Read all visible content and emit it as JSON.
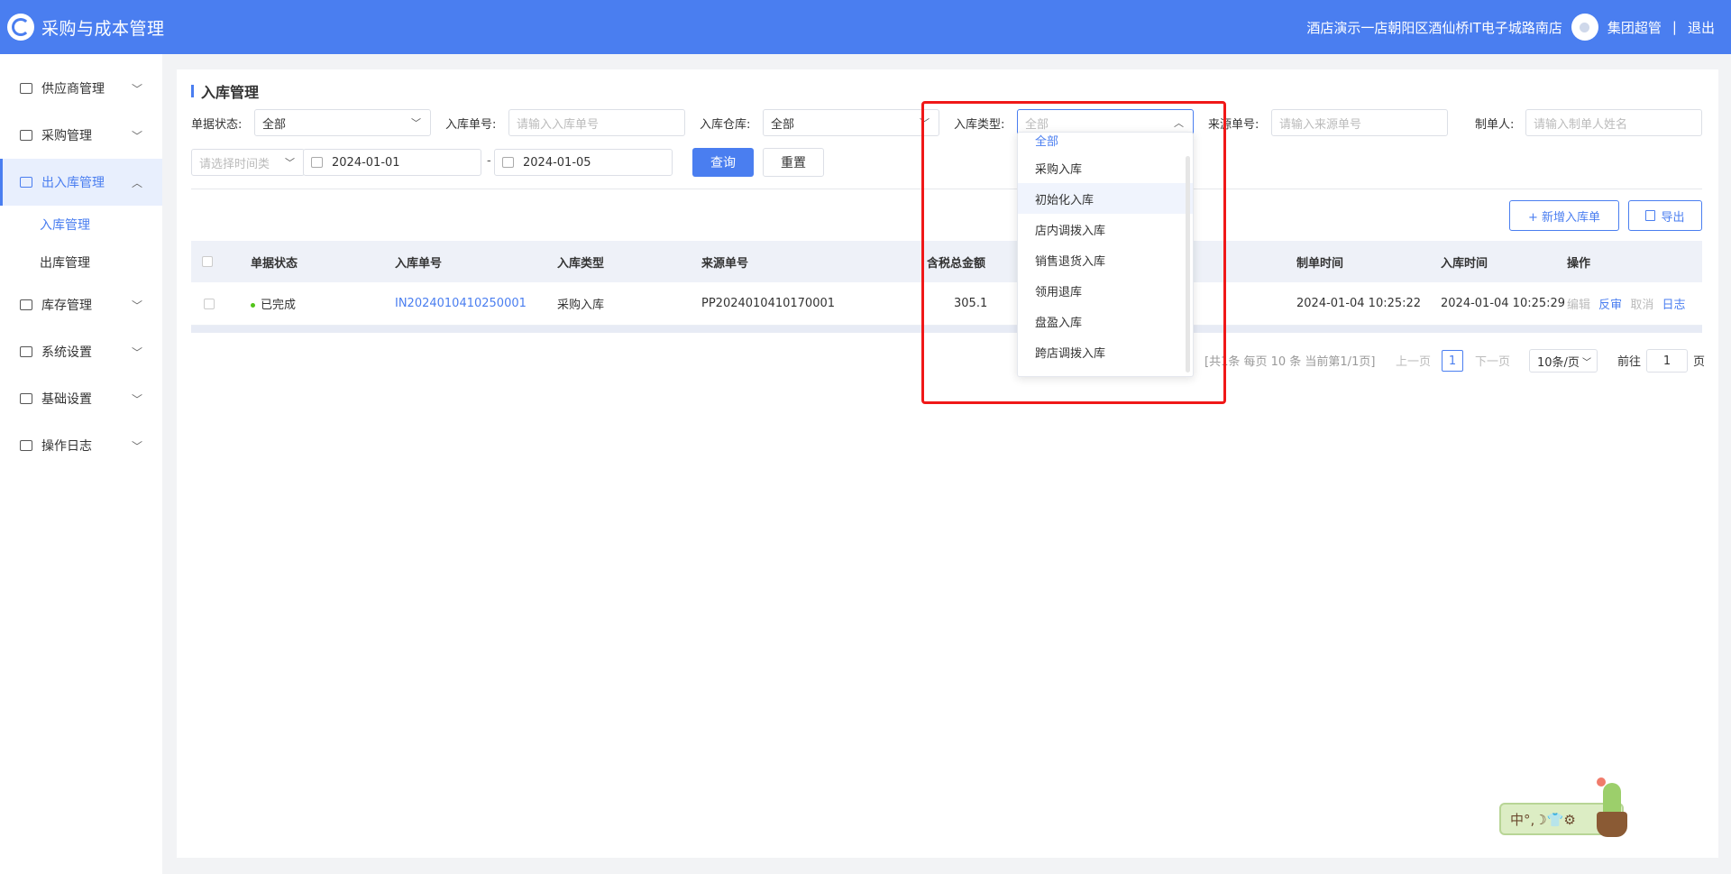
{
  "header": {
    "app_title": "采购与成本管理",
    "store_name": "酒店演示一店朝阳区酒仙桥IT电子城路南店",
    "user_name": "集团超管",
    "separator": "|",
    "logout": "退出"
  },
  "sidebar": {
    "items": [
      {
        "label": "供应商管理"
      },
      {
        "label": "采购管理"
      },
      {
        "label": "出入库管理"
      },
      {
        "label": "库存管理"
      },
      {
        "label": "系统设置"
      },
      {
        "label": "基础设置"
      },
      {
        "label": "操作日志"
      }
    ],
    "sub_items": [
      {
        "label": "入库管理"
      },
      {
        "label": "出库管理"
      }
    ]
  },
  "page": {
    "title": "入库管理"
  },
  "filters": {
    "status_label": "单据状态:",
    "status_value": "全部",
    "order_no_label": "入库单号:",
    "order_no_placeholder": "请输入入库单号",
    "warehouse_label": "入库仓库:",
    "warehouse_value": "全部",
    "type_label": "入库类型:",
    "type_placeholder": "全部",
    "source_label": "来源单号:",
    "source_placeholder": "请输入来源单号",
    "creator_label": "制单人:",
    "creator_placeholder": "请输入制单人姓名",
    "time_type_placeholder": "请选择时间类",
    "start_date": "2024-01-01",
    "date_sep": "-",
    "end_date": "2024-01-05",
    "query_button": "查询",
    "reset_button": "重置"
  },
  "actions": {
    "add_button": "+ 新增入库单",
    "export_button": "导出"
  },
  "table": {
    "columns": [
      "单据状态",
      "入库单号",
      "入库类型",
      "来源单号",
      "含税总金额",
      "制单时间",
      "入库时间",
      "操作"
    ],
    "rows": [
      {
        "status": "已完成",
        "order_no": "IN2024010410250001",
        "type": "采购入库",
        "source_no": "PP2024010410170001",
        "amount": "305.1",
        "created_time": "2024-01-04 10:25:22",
        "stock_time": "2024-01-04 10:25:29",
        "op_edit": "编辑",
        "op_reverse": "反审",
        "op_cancel": "取消",
        "op_log": "日志"
      }
    ]
  },
  "pagination": {
    "summary": "[共1条 每页 10 条 当前第1/1页]",
    "prev": "上一页",
    "current": "1",
    "next": "下一页",
    "page_size": "10条/页",
    "goto_label": "前往",
    "goto_value": "1",
    "goto_suffix": "页"
  },
  "dropdown": {
    "options": [
      "全部",
      "采购入库",
      "初始化入库",
      "店内调拨入库",
      "销售退货入库",
      "领用退库",
      "盘盈入库",
      "跨店调拨入库"
    ],
    "selected": "全部"
  },
  "widget": {
    "text": "中°,☽👕⚙"
  },
  "colors": {
    "primary": "#4a7ef0",
    "highlight": "#f01818",
    "success": "#52c41a"
  }
}
